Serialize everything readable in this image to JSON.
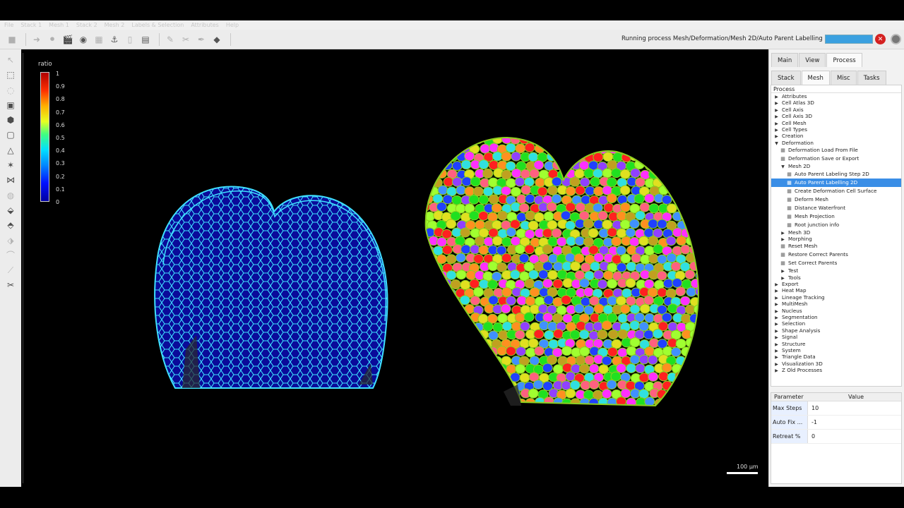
{
  "menu": [
    "File",
    "Stack 1",
    "Mesh 1",
    "Stack 2",
    "Mesh 2",
    "Labels & Selection",
    "Attributes",
    "Help"
  ],
  "status": {
    "text": "Running process Mesh/Deformation/Mesh 2D/Auto Parent Labelling 2D",
    "progress": 1.0
  },
  "colorbar": {
    "title": "ratio",
    "ticks": [
      "1",
      "0.9",
      "0.8",
      "0.7",
      "0.6",
      "0.5",
      "0.4",
      "0.3",
      "0.2",
      "0.1",
      "0"
    ]
  },
  "scalebar": {
    "label": "100 µm"
  },
  "tabs_top": [
    {
      "label": "Main",
      "active": false
    },
    {
      "label": "View",
      "active": false
    },
    {
      "label": "Process",
      "active": true
    }
  ],
  "tabs_sub": [
    {
      "label": "Stack",
      "active": false
    },
    {
      "label": "Mesh",
      "active": true
    },
    {
      "label": "Misc",
      "active": false
    },
    {
      "label": "Tasks",
      "active": false
    }
  ],
  "process": {
    "header": "Process",
    "tree": [
      {
        "label": "Attributes",
        "depth": 0,
        "arrow": "right"
      },
      {
        "label": "Cell Atlas 3D",
        "depth": 0,
        "arrow": "right"
      },
      {
        "label": "Cell Axis",
        "depth": 0,
        "arrow": "right"
      },
      {
        "label": "Cell Axis 3D",
        "depth": 0,
        "arrow": "right"
      },
      {
        "label": "Cell Mesh",
        "depth": 0,
        "arrow": "right"
      },
      {
        "label": "Cell Types",
        "depth": 0,
        "arrow": "right"
      },
      {
        "label": "Creation",
        "depth": 0,
        "arrow": "right"
      },
      {
        "label": "Deformation",
        "depth": 0,
        "arrow": "down"
      },
      {
        "label": "Deformation Load From File",
        "depth": 1,
        "leaf": true
      },
      {
        "label": "Deformation Save or Export",
        "depth": 1,
        "leaf": true
      },
      {
        "label": "Mesh 2D",
        "depth": 1,
        "arrow": "down"
      },
      {
        "label": "Auto Parent Labeling Step 2D",
        "depth": 2,
        "leaf": true
      },
      {
        "label": "Auto Parent Labelling 2D",
        "depth": 2,
        "leaf": true,
        "selected": true
      },
      {
        "label": "Create Deformation Cell Surface",
        "depth": 2,
        "leaf": true
      },
      {
        "label": "Deform Mesh",
        "depth": 2,
        "leaf": true
      },
      {
        "label": "Distance Waterfront",
        "depth": 2,
        "leaf": true
      },
      {
        "label": "Mesh Projection",
        "depth": 2,
        "leaf": true
      },
      {
        "label": "Root junction info",
        "depth": 2,
        "leaf": true
      },
      {
        "label": "Mesh 3D",
        "depth": 1,
        "arrow": "right"
      },
      {
        "label": "Morphing",
        "depth": 1,
        "arrow": "right"
      },
      {
        "label": "Reset Mesh",
        "depth": 1,
        "leaf": true
      },
      {
        "label": "Restore Correct Parents",
        "depth": 1,
        "leaf": true
      },
      {
        "label": "Set Correct Parents",
        "depth": 1,
        "leaf": true
      },
      {
        "label": "Test",
        "depth": 1,
        "arrow": "right"
      },
      {
        "label": "Tools",
        "depth": 1,
        "arrow": "right"
      },
      {
        "label": "Export",
        "depth": 0,
        "arrow": "right"
      },
      {
        "label": "Heat Map",
        "depth": 0,
        "arrow": "right"
      },
      {
        "label": "Lineage Tracking",
        "depth": 0,
        "arrow": "right"
      },
      {
        "label": "MultiMesh",
        "depth": 0,
        "arrow": "right"
      },
      {
        "label": "Nucleus",
        "depth": 0,
        "arrow": "right"
      },
      {
        "label": "Segmentation",
        "depth": 0,
        "arrow": "right"
      },
      {
        "label": "Selection",
        "depth": 0,
        "arrow": "right"
      },
      {
        "label": "Shape Analysis",
        "depth": 0,
        "arrow": "right"
      },
      {
        "label": "Signal",
        "depth": 0,
        "arrow": "right"
      },
      {
        "label": "Structure",
        "depth": 0,
        "arrow": "right"
      },
      {
        "label": "System",
        "depth": 0,
        "arrow": "right"
      },
      {
        "label": "Triangle Data",
        "depth": 0,
        "arrow": "right"
      },
      {
        "label": "Visualization 3D",
        "depth": 0,
        "arrow": "right"
      },
      {
        "label": "Z Old Processes",
        "depth": 0,
        "arrow": "right"
      }
    ]
  },
  "params": {
    "col_name": "Parameter",
    "col_value": "Value",
    "rows": [
      {
        "name": "Max Steps",
        "value": "10"
      },
      {
        "name": "Auto Fix ...",
        "value": "-1"
      },
      {
        "name": "Retreat %",
        "value": "0"
      }
    ]
  },
  "colors": {
    "selection": "#3a8ee6",
    "mesh_left_fill": "#0a0a9a",
    "mesh_left_edges": "#3fe0ff",
    "mesh_right_edges": "#8ccf20"
  }
}
